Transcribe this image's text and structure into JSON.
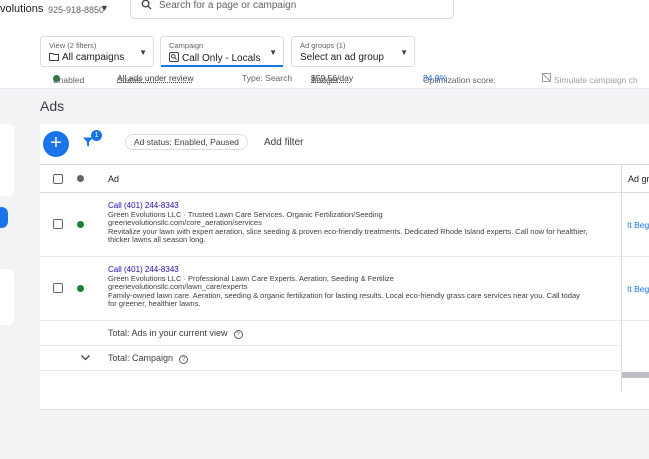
{
  "account": {
    "name": "volutions",
    "phone": "925-918-8850"
  },
  "search": {
    "placeholder": "Search for a page or campaign"
  },
  "filters": {
    "view": {
      "label": "View (2 filters)",
      "value": "All campaigns"
    },
    "campaign": {
      "label": "Campaign",
      "value": "Call Only - Locals"
    },
    "ad_group": {
      "label": "Ad groups (1)",
      "value": "Select an ad group"
    }
  },
  "status_row": {
    "enabled": "Enabled",
    "status_label": "Status:",
    "status_value": "All ads under review",
    "type": "Type: Search",
    "budget_label": "Budget:",
    "budget_value": "$59.56/day",
    "opt_label": "Optimization score:",
    "opt_value": "84.9%",
    "simulate": "Simulate campaign ch"
  },
  "section_title": "Ads",
  "toolbar": {
    "filter_badge": "1",
    "status_chip": "Ad status: Enabled, Paused",
    "add_filter": "Add filter"
  },
  "table": {
    "headers": {
      "ad": "Ad",
      "ad_group": "Ad gr"
    },
    "rows": [
      {
        "headline": "Call (401) 244-8343",
        "business": "Green Evolutions LLC · Trusted Lawn Care Services. Organic Fertilization/Seeding",
        "url": "greenevolutionsllc.com/core_aeration/services",
        "desc1": "Revitalize your lawn with expert aeration, slice seeding & proven eco-friendly treatments. Dedicated Rhode Island experts. Call now for healthier,",
        "desc2": "thicker lawns all season long.",
        "ad_group": "It Beg"
      },
      {
        "headline": "Call (401) 244-8343",
        "business": "Green Evolutions LLC · Professional Lawn Care Experts. Aeration, Seeding & Fertilize",
        "url": "greenevolutionsllc.com/lawn_care/experts",
        "desc1": "Family-owned lawn care. Aeration, seeding & organic fertilization for lasting results. Local eco-friendly grass care services near you. Call today",
        "desc2": "for greener, healthier lawns.",
        "ad_group": "It Beg"
      }
    ],
    "total_view": "Total: Ads in your current view",
    "total_campaign": "Total: Campaign"
  },
  "colors": {
    "accent": "#1a73e8",
    "enabled_green": "#188038"
  }
}
